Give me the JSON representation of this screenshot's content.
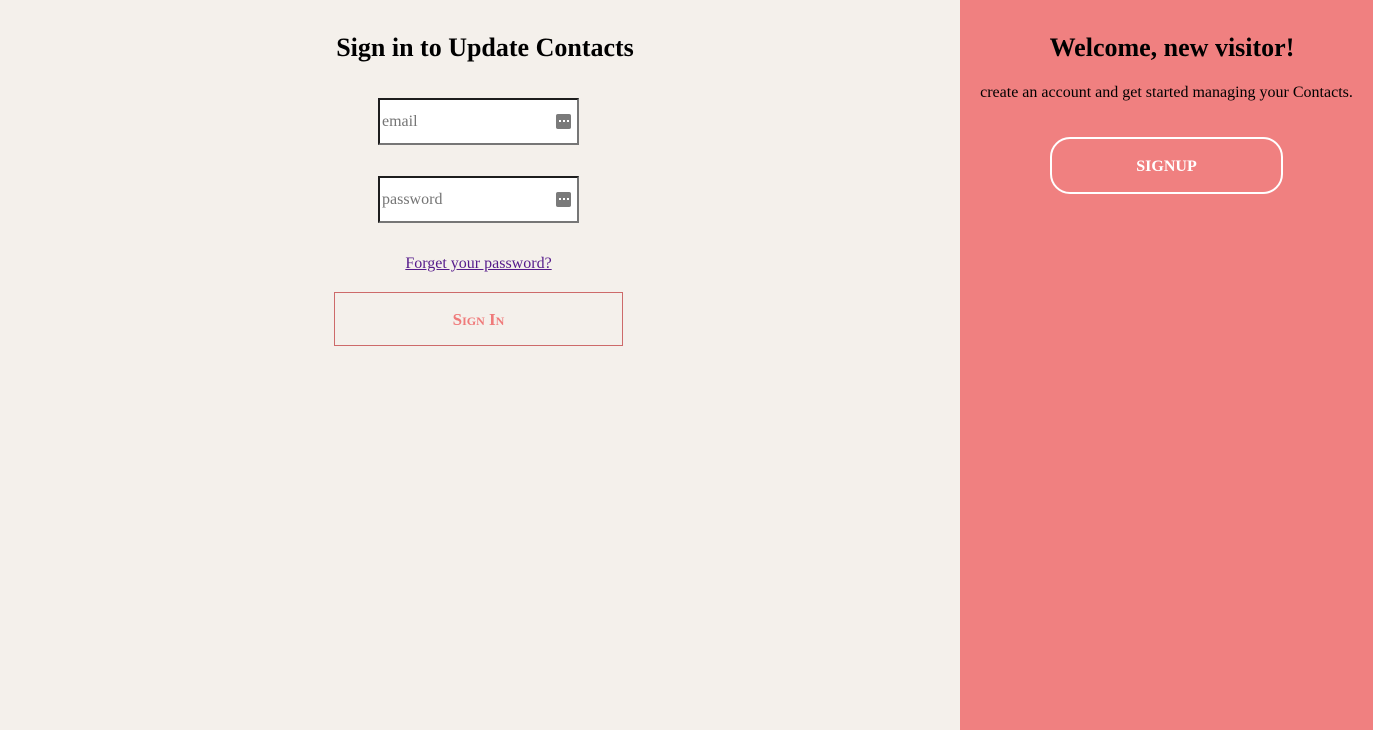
{
  "signin": {
    "title": "Sign in to Update Contacts",
    "email_placeholder": "email",
    "password_placeholder": "password",
    "forgot_label": "Forget your password?",
    "button_label": "Sign In"
  },
  "signup": {
    "title": "Welcome, new visitor!",
    "text": "create an account and get started managing your Contacts.",
    "button_label": "SIGNUP"
  },
  "icons": {
    "field_icon": "password-manager-key-icon"
  },
  "colors": {
    "left_background": "#f4f0eb",
    "right_background": "#f08080",
    "signin_accent": "#ef7a7a",
    "link": "#551a8b"
  }
}
